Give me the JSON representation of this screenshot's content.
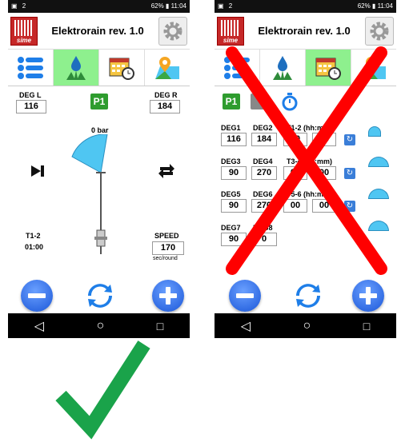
{
  "status_bar": {
    "left": "▣ 24",
    "right_left": "62%",
    "time_left": "11:04",
    "right_right": "62%",
    "time_right": "11:04"
  },
  "app": {
    "title": "Elektrorain rev. 1.0",
    "logo_text": "sime"
  },
  "left_screen": {
    "deg_l_label": "DEG L",
    "deg_l_value": "116",
    "deg_r_label": "DEG R",
    "deg_r_value": "184",
    "program_badge": "P1",
    "pressure": "0 bar",
    "t_label": "T1-2",
    "t_value": "01:00",
    "speed_label": "SPEED",
    "speed_value": "170",
    "speed_unit": "sec/round"
  },
  "right_screen": {
    "program_badge": "P1",
    "rows": [
      {
        "deg_a": "DEG1",
        "deg_b": "DEG2",
        "t": "T1-2 (hh:mm)",
        "val_a": "116",
        "val_b": "184",
        "time_a": "00",
        "time_b": "00"
      },
      {
        "deg_a": "DEG3",
        "deg_b": "DEG4",
        "t": "T3-4 (hh:mm)",
        "val_a": "90",
        "val_b": "270",
        "time_a": "00",
        "time_b": "00"
      },
      {
        "deg_a": "DEG5",
        "deg_b": "DEG6",
        "t": "T5-6 (hh:mm)",
        "val_a": "90",
        "val_b": "270",
        "time_a": "00",
        "time_b": "00"
      },
      {
        "deg_a": "DEG7",
        "deg_b": "DEG8",
        "val_a": "90",
        "val_b": "0"
      }
    ]
  },
  "colors": {
    "accent_green": "#8ef08e",
    "blue": "#1a56d8",
    "red_cross": "#ff0000",
    "check_green": "#1aa34a",
    "cyan": "#4fc6f2"
  },
  "icons": [
    "list-icon",
    "water-drop-icon",
    "calendar-clock-icon",
    "map-pin-icon",
    "gear-icon",
    "minus-icon",
    "refresh-icon",
    "plus-icon",
    "play-end-icon",
    "swap-arrows-icon",
    "back-icon",
    "home-icon",
    "recent-icon",
    "check-mark-icon",
    "cross-mark-icon"
  ]
}
